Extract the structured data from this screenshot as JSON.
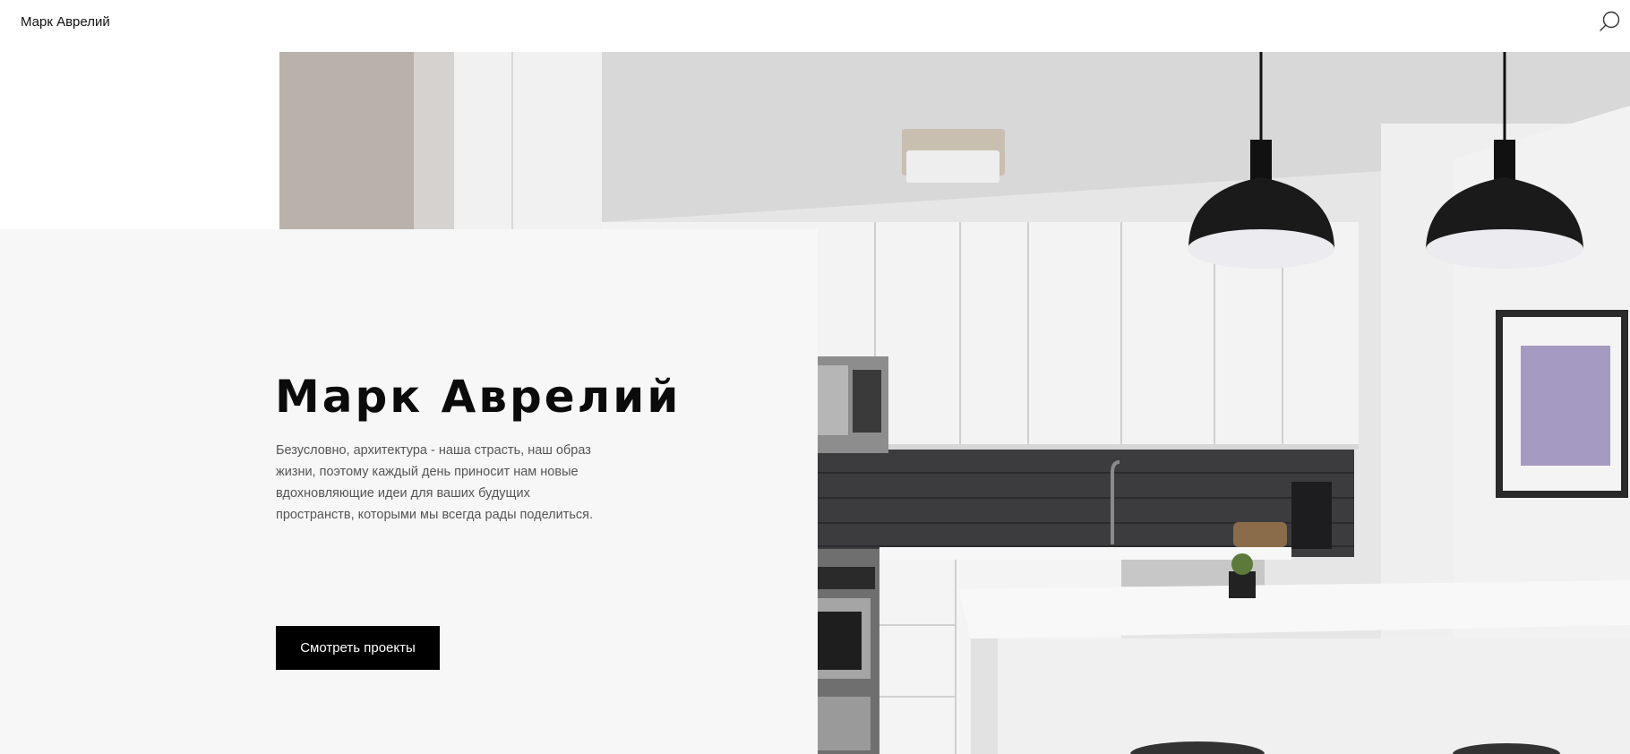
{
  "header": {
    "brand": "Марк Аврелий",
    "search_icon": "search-icon"
  },
  "hero": {
    "title": "Марк Аврелий",
    "description": "Безусловно, архитектура - наша страсть, наш образ жизни, поэтому каждый день приносит нам новые вдохновляющие идеи для ваших будущих пространств, которыми мы всегда рады поделиться.",
    "button_label": "Смотреть проекты",
    "image": "kitchen-interior-photo"
  },
  "colors": {
    "panel_background": "#f7f7f7",
    "button_background": "#000000",
    "button_text": "#ffffff"
  }
}
